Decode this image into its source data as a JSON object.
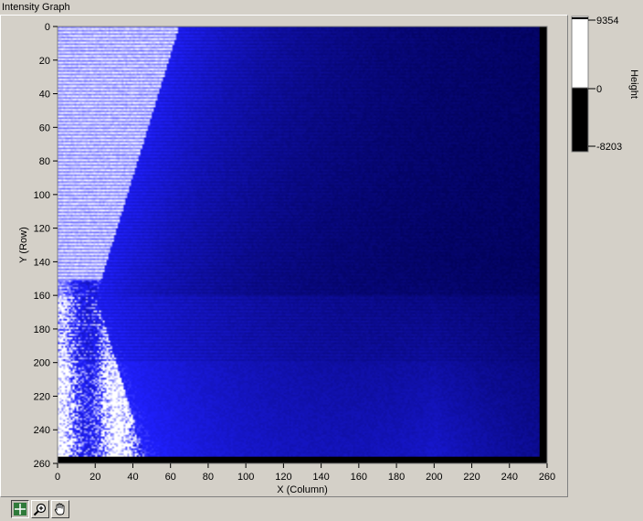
{
  "window": {
    "title": "Intensity Graph"
  },
  "chart_data": {
    "type": "heatmap",
    "title": "",
    "xlabel": "X (Column)",
    "ylabel": "Y (Row)",
    "xlim": [
      0,
      260
    ],
    "ylim": [
      0,
      260
    ],
    "y_inverted": true,
    "x_ticks": [
      0,
      20,
      40,
      60,
      80,
      100,
      120,
      140,
      160,
      180,
      200,
      220,
      240,
      260
    ],
    "y_ticks": [
      0,
      20,
      40,
      60,
      80,
      100,
      120,
      140,
      160,
      180,
      200,
      220,
      240,
      260
    ],
    "data_extent": {
      "columns": 256,
      "rows": 256
    },
    "colorbar": {
      "label": "Height",
      "max": 9354,
      "mid": 0,
      "min": -8203,
      "tick_labels": [
        "9354",
        "0",
        "-8203"
      ],
      "colors": {
        "high": "#ffffff",
        "low": "#000000"
      }
    },
    "colormap": {
      "bright": "#ffffff",
      "mid": "#2020ff",
      "dark": "#000050",
      "edge": "#000000"
    },
    "grid": false
  },
  "toolbar": {
    "tools": [
      {
        "name": "cursor-tool",
        "icon": "crosshair-icon",
        "active": true
      },
      {
        "name": "zoom-tool",
        "icon": "zoom-icon",
        "active": false
      },
      {
        "name": "pan-tool",
        "icon": "hand-icon",
        "active": false
      }
    ]
  }
}
